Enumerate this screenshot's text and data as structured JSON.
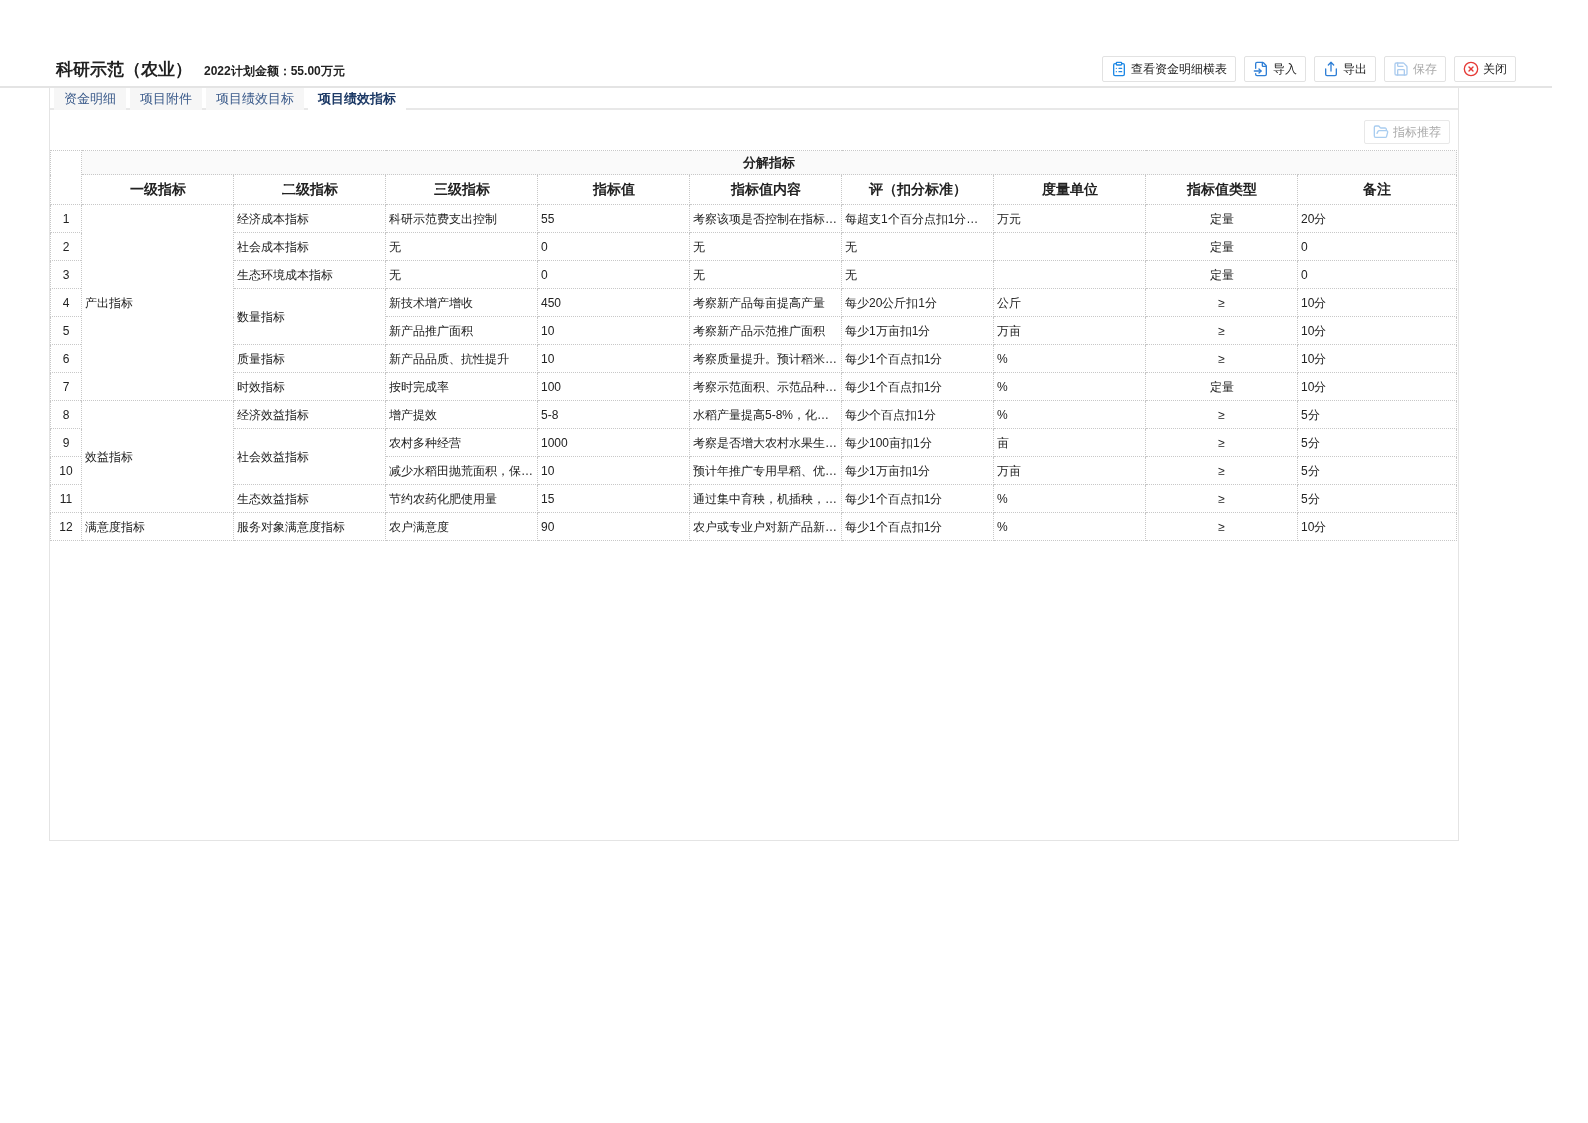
{
  "header": {
    "title": "科研示范（农业）",
    "amount": "2022计划金额：55.00万元"
  },
  "toolbar": [
    {
      "kind": "clipboard",
      "label": "查看资金明细横表",
      "disabled": false
    },
    {
      "kind": "import",
      "label": "导入",
      "disabled": false
    },
    {
      "kind": "export",
      "label": "导出",
      "disabled": false
    },
    {
      "kind": "save",
      "label": "保存",
      "disabled": true
    },
    {
      "kind": "close",
      "label": "关闭",
      "disabled": false
    }
  ],
  "tabs": [
    {
      "label": "资金明细",
      "selected": false
    },
    {
      "label": "项目附件",
      "selected": false
    },
    {
      "label": "项目绩效目标",
      "selected": false
    },
    {
      "label": "项目绩效指标",
      "selected": true
    }
  ],
  "recommend_button": {
    "label": "指标推荐",
    "disabled": true
  },
  "table": {
    "group_header": "分解指标",
    "columns": [
      "一级指标",
      "二级指标",
      "三级指标",
      "指标值",
      "指标值内容",
      "评（扣分标准）",
      "度量单位",
      "指标值类型",
      "备注"
    ],
    "groups": [
      {
        "level1": "产出指标",
        "children": [
          {
            "level2": "经济成本指标",
            "rows": [
              {
                "no": "1",
                "level3": "科研示范费支出控制",
                "value": "55",
                "content": "考察该项是否控制在指标…",
                "standard": "每超支1个百分点扣1分…",
                "unit": "万元",
                "type": "定量",
                "note": "20分"
              }
            ]
          },
          {
            "level2": "社会成本指标",
            "rows": [
              {
                "no": "2",
                "level3": "无",
                "value": "0",
                "content": "无",
                "standard": "无",
                "unit": "",
                "type": "定量",
                "note": "0"
              }
            ]
          },
          {
            "level2": "生态环境成本指标",
            "rows": [
              {
                "no": "3",
                "level3": "无",
                "value": "0",
                "content": "无",
                "standard": "无",
                "unit": "",
                "type": "定量",
                "note": "0"
              }
            ]
          },
          {
            "level2": "数量指标",
            "rows": [
              {
                "no": "4",
                "level3": "新技术增产增收",
                "value": "450",
                "content": "考察新产品每亩提高产量",
                "standard": "每少20公斤扣1分",
                "unit": "公斤",
                "type": "≥",
                "note": "10分"
              },
              {
                "no": "5",
                "level3": "新产品推广面积",
                "value": "10",
                "content": "考察新产品示范推广面积",
                "standard": "每少1万亩扣1分",
                "unit": "万亩",
                "type": "≥",
                "note": "10分"
              }
            ]
          },
          {
            "level2": "质量指标",
            "rows": [
              {
                "no": "6",
                "level3": "新产品品质、抗性提升",
                "value": "10",
                "content": "考察质量提升。预计稻米…",
                "standard": "每少1个百点扣1分",
                "unit": "%",
                "type": "≥",
                "note": "10分"
              }
            ]
          },
          {
            "level2": "时效指标",
            "rows": [
              {
                "no": "7",
                "level3": "按时完成率",
                "value": "100",
                "content": "考察示范面积、示范品种…",
                "standard": "每少1个百点扣1分",
                "unit": "%",
                "type": "定量",
                "note": "10分"
              }
            ]
          }
        ]
      },
      {
        "level1": "效益指标",
        "children": [
          {
            "level2": "经济效益指标",
            "rows": [
              {
                "no": "8",
                "level3": "增产提效",
                "value": "5-8",
                "content": "水稻产量提高5-8%，化…",
                "standard": "每少个百点扣1分",
                "unit": "%",
                "type": "≥",
                "note": "5分"
              }
            ]
          },
          {
            "level2": "社会效益指标",
            "rows": [
              {
                "no": "9",
                "level3": "农村多种经营",
                "value": "1000",
                "content": "考察是否增大农村水果生…",
                "standard": "每少100亩扣1分",
                "unit": "亩",
                "type": "≥",
                "note": "5分"
              },
              {
                "no": "10",
                "level3": "减少水稻田抛荒面积，保…",
                "value": "10",
                "content": "预计年推广专用早稻、优…",
                "standard": "每少1万亩扣1分",
                "unit": "万亩",
                "type": "≥",
                "note": "5分"
              }
            ]
          },
          {
            "level2": "生态效益指标",
            "rows": [
              {
                "no": "11",
                "level3": "节约农药化肥使用量",
                "value": "15",
                "content": "通过集中育秧，机插秧，…",
                "standard": "每少1个百点扣1分",
                "unit": "%",
                "type": "≥",
                "note": "5分"
              }
            ]
          }
        ]
      },
      {
        "level1": "满意度指标",
        "children": [
          {
            "level2": "服务对象满意度指标",
            "rows": [
              {
                "no": "12",
                "level3": "农户满意度",
                "value": "90",
                "content": "农户或专业户对新产品新…",
                "standard": "每少1个百点扣1分",
                "unit": "%",
                "type": "≥",
                "note": "10分"
              }
            ]
          }
        ]
      }
    ]
  }
}
